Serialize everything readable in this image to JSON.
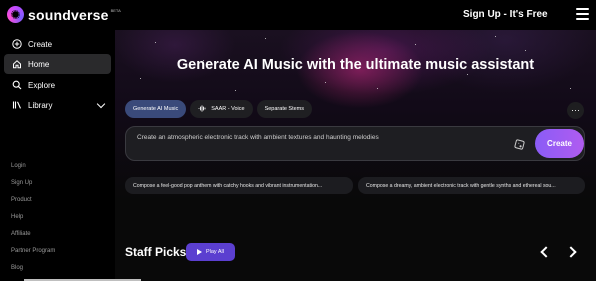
{
  "brand": {
    "name": "soundverse",
    "badge": "BETA"
  },
  "header": {
    "cta": "Sign Up - It's Free",
    "menu_icon": "hamburger-icon"
  },
  "sidebar": {
    "items": [
      {
        "label": "Create",
        "icon": "plus-circle-icon"
      },
      {
        "label": "Home",
        "icon": "home-icon",
        "active": true
      },
      {
        "label": "Explore",
        "icon": "search-icon"
      },
      {
        "label": "Library",
        "icon": "library-icon"
      }
    ],
    "footer_links": [
      "Login",
      "Sign Up",
      "Product",
      "Help",
      "Affiliate",
      "Partner Program",
      "Blog"
    ]
  },
  "hero": {
    "title": "Generate AI Music with the ultimate music assistant"
  },
  "tabs": [
    {
      "label": "Generate AI Music",
      "active": true
    },
    {
      "label": "SAAR - Voice",
      "icon": "waveform-icon"
    },
    {
      "label": "Separate Stems"
    }
  ],
  "more_label": "···",
  "prompt": {
    "text": "Create an atmospheric electronic track with ambient textures and haunting melodies",
    "create_label": "Create"
  },
  "suggestions": [
    "Compose a feel-good pop anthem with catchy hooks and vibrant instrumentation...",
    "Compose a dreamy, ambient electronic track with gentle synths and ethereal sou..."
  ],
  "staff_picks": {
    "title": "Staff Picks",
    "play_label": "Play All"
  },
  "colors": {
    "accent": "#8a5cf6",
    "play": "#5b3fd0",
    "active_tab": "#3a4a7a"
  }
}
